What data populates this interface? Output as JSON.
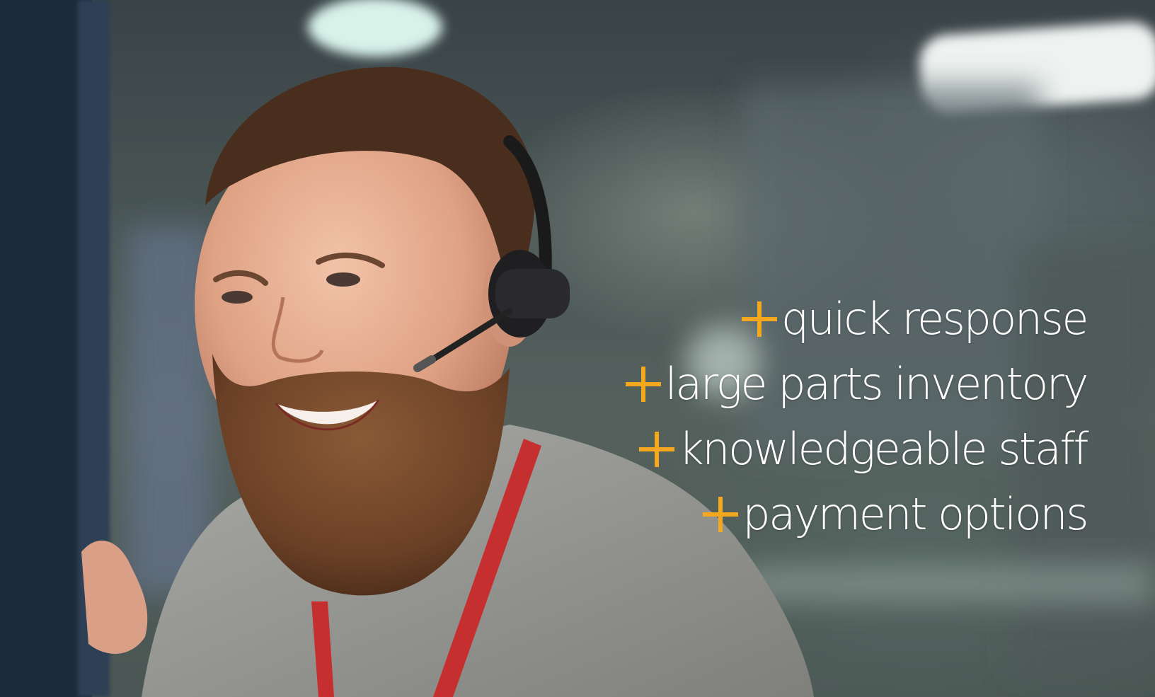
{
  "image": {
    "subject": "smiling bearded man wearing a headset in an office",
    "accent_color": "#f4a81d",
    "text_color": "#ffffff"
  },
  "benefits": {
    "icon": "plus-icon",
    "items": [
      {
        "label": "quick response"
      },
      {
        "label": "large parts inventory"
      },
      {
        "label": "knowledgeable staff"
      },
      {
        "label": "payment options"
      }
    ]
  }
}
